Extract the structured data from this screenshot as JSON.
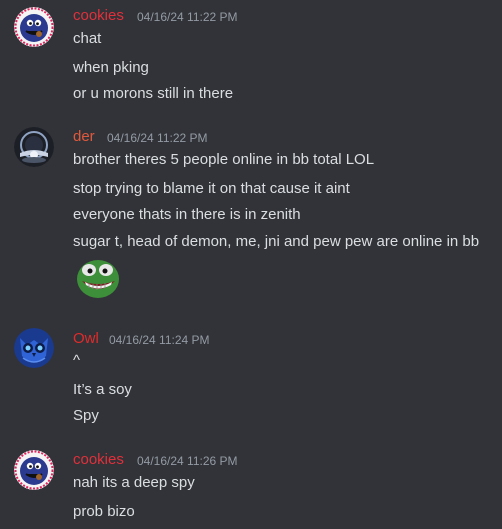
{
  "colors": {
    "background": "#313338",
    "text": "#dbdee1",
    "timestamp": "#949ba4",
    "cookies": "#e1303a",
    "der": "#e0593c",
    "owl": "#e02b2b"
  },
  "messages": [
    {
      "author": "cookies",
      "timestamp": "04/16/24 11:22 PM",
      "avatar_icon": "cookie-monster-avatar",
      "lines": [
        "chat",
        "when pking",
        "or u morons still in there"
      ]
    },
    {
      "author": "der",
      "timestamp": "04/16/24 11:22 PM",
      "avatar_icon": "moon-orb-avatar",
      "lines": [
        "brother theres 5 people online in bb total LOL",
        "stop trying to blame it on that cause it aint",
        "everyone thats in there is in zenith",
        "sugar t, head of demon, me, jni and pew pew are online in bb"
      ],
      "attachment": "pepe-grin-emoji"
    },
    {
      "author": "Owl",
      "timestamp": "04/16/24 11:24 PM",
      "avatar_icon": "blue-owl-avatar",
      "lines": [
        "^",
        "It’s a soy",
        "Spy"
      ]
    },
    {
      "author": "cookies",
      "timestamp": "04/16/24 11:26 PM",
      "avatar_icon": "cookie-monster-avatar",
      "lines": [
        "nah its a deep spy",
        "prob bizo"
      ]
    }
  ]
}
